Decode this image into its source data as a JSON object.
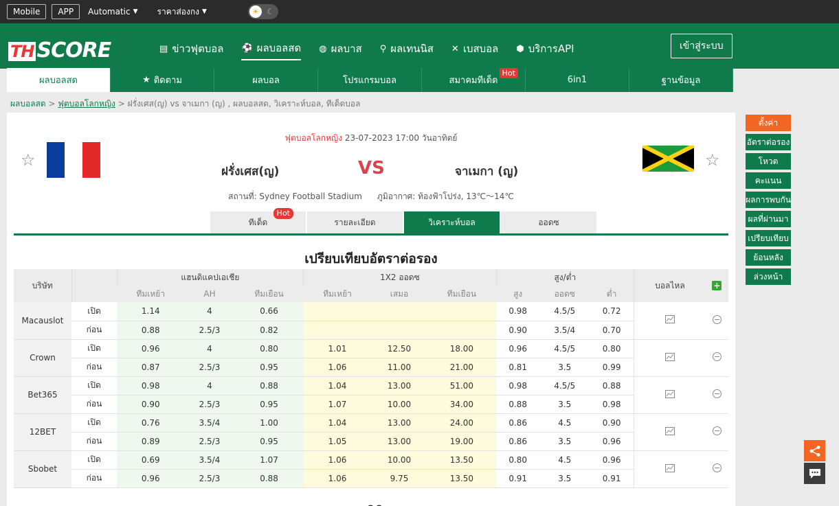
{
  "topbar": {
    "mobile": "Mobile",
    "app": "APP",
    "automatic": "Automatic",
    "price": "ราคาส่องกง"
  },
  "logo": {
    "th": "TH",
    "score": "SCORE"
  },
  "nav": [
    {
      "label": "ข่าวฟุตบอล",
      "icon": "news-icon"
    },
    {
      "label": "ผลบอลสด",
      "icon": "soccer-ball-icon"
    },
    {
      "label": "ผลบาส",
      "icon": "basketball-icon"
    },
    {
      "label": "ผลเทนนิส",
      "icon": "tennis-icon"
    },
    {
      "label": "เบสบอล",
      "icon": "baseball-icon"
    },
    {
      "label": "บริการAPI",
      "icon": "api-icon"
    }
  ],
  "login": "เข้าสู่ระบบ",
  "subnav": [
    "ผลบอลสด",
    "ติดตาม",
    "ผลบอล",
    "โปรแกรมบอล",
    "สมาคมทีเด็ด",
    "6in1",
    "ฐานข้อมูล"
  ],
  "hot": "Hot",
  "breadcrumb": {
    "home": "ผลบอลสด",
    "league": "ฟุตบอลโลกหญิง",
    "rest": "ฝรั่งเศส(ญ) vs  จาเมกา (ญ) ,  ผลบอลสด,  วิเคราะห์บอล,  ทีเด็ดบอล"
  },
  "match": {
    "league": "ฟุตบอลโลกหญิง",
    "datetime": "23-07-2023 17:00 วันอาทิตย์",
    "home": "ฝรั่งเศส(ญ)",
    "away": "จาเมกา (ญ)",
    "vs": "VS",
    "venue": "สถานที่: Sydney Football Stadium",
    "weather": "ภูมิอากาศ: ท้องฟ้าโปร่ง, 13℃～14℃"
  },
  "match_tabs": [
    "ทีเด็ด",
    "รายละเอียด",
    "วิเคราะห์บอล",
    "ออดซ"
  ],
  "section_title": "เปรียบเทียบอัตราต่อรอง",
  "table": {
    "company": "บริษัท",
    "ah": "แฮนดิแคปเอเชีย",
    "x12": "1X2 ออดซ",
    "ou": "สูง/ต่ำ",
    "live": "บอลไหล",
    "sub": [
      "ทีมเหย้า",
      "AH",
      "ทีมเยือน",
      "ทีมเหย้า",
      "เสมอ",
      "ทีมเยือน",
      "สูง",
      "ออดซ",
      "ต่ำ"
    ],
    "open": "เปิด",
    "prev": "ก่อน",
    "rows": [
      {
        "company": "Macauslot",
        "open": [
          "1.14",
          "4",
          "0.66",
          "",
          "",
          "",
          "0.98",
          "4.5/5",
          "0.72"
        ],
        "prev": [
          "0.88",
          "2.5/3",
          "0.82",
          "",
          "",
          "",
          "0.90",
          "3.5/4",
          "0.70"
        ]
      },
      {
        "company": "Crown",
        "open": [
          "0.96",
          "4",
          "0.80",
          "1.01",
          "12.50",
          "18.00",
          "0.96",
          "4.5/5",
          "0.80"
        ],
        "prev": [
          "0.87",
          "2.5/3",
          "0.95",
          "1.06",
          "11.00",
          "21.00",
          "0.81",
          "3.5",
          "0.99"
        ]
      },
      {
        "company": "Bet365",
        "open": [
          "0.98",
          "4",
          "0.88",
          "1.04",
          "13.00",
          "51.00",
          "0.98",
          "4.5/5",
          "0.88"
        ],
        "prev": [
          "0.90",
          "2.5/3",
          "0.95",
          "1.07",
          "10.00",
          "34.00",
          "0.88",
          "3.5",
          "0.98"
        ]
      },
      {
        "company": "12BET",
        "open": [
          "0.76",
          "3.5/4",
          "1.00",
          "1.04",
          "13.00",
          "24.00",
          "0.86",
          "4.5",
          "0.90"
        ],
        "prev": [
          "0.89",
          "2.5/3",
          "0.95",
          "1.05",
          "13.00",
          "19.00",
          "0.86",
          "3.5",
          "0.96"
        ]
      },
      {
        "company": "Sbobet",
        "open": [
          "0.69",
          "3.5/4",
          "1.07",
          "1.06",
          "10.00",
          "13.50",
          "0.80",
          "4.5",
          "0.96"
        ],
        "prev": [
          "0.96",
          "2.5/3",
          "0.88",
          "1.06",
          "9.75",
          "13.50",
          "0.91",
          "3.5",
          "0.91"
        ]
      }
    ]
  },
  "side": [
    "ตั้งค่า",
    "อัตราต่อรอง",
    "โหวต",
    "คะแนน",
    "ผลการพบกัน",
    "ผลที่ผ่านมา",
    "เปรียบเทียบ",
    "ย้อนหลัง",
    "ล่วงหน้า"
  ],
  "bottom_title": "สถิติ"
}
